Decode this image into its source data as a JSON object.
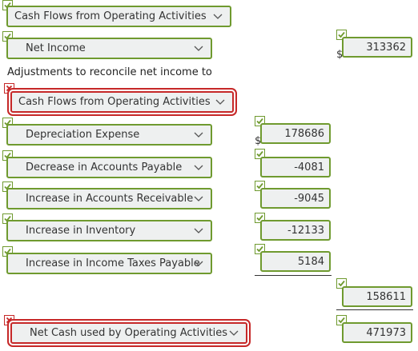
{
  "rows": {
    "header_select": "Cash Flows from Operating Activities",
    "net_income_select": "Net Income",
    "net_income_value": "313362",
    "adjustments_label": "Adjustments to reconcile net income to",
    "adjustments_select": "Cash Flows from Operating Activities",
    "depreciation_select": "Depreciation Expense",
    "depreciation_value": "178686",
    "payable_select": "Decrease in Accounts Payable",
    "payable_value": "-4081",
    "receivable_select": "Increase in Accounts Receivable",
    "receivable_value": "-9045",
    "inventory_select": "Increase in Inventory",
    "inventory_value": "-12133",
    "taxes_select": "Increase in Income Taxes Payable",
    "taxes_value": "5184",
    "total_adjustments_value": "158611",
    "net_cash_select": "Net Cash used by Operating Activities",
    "net_cash_value": "471973"
  },
  "currency_symbol": "$",
  "colors": {
    "correct": "#6f9a2f",
    "incorrect": "#c62828",
    "field_bg": "#eef0f0"
  },
  "icons": {
    "correct": "checkmark-icon",
    "incorrect": "x-mark-icon",
    "dropdown": "chevron-down-icon"
  }
}
